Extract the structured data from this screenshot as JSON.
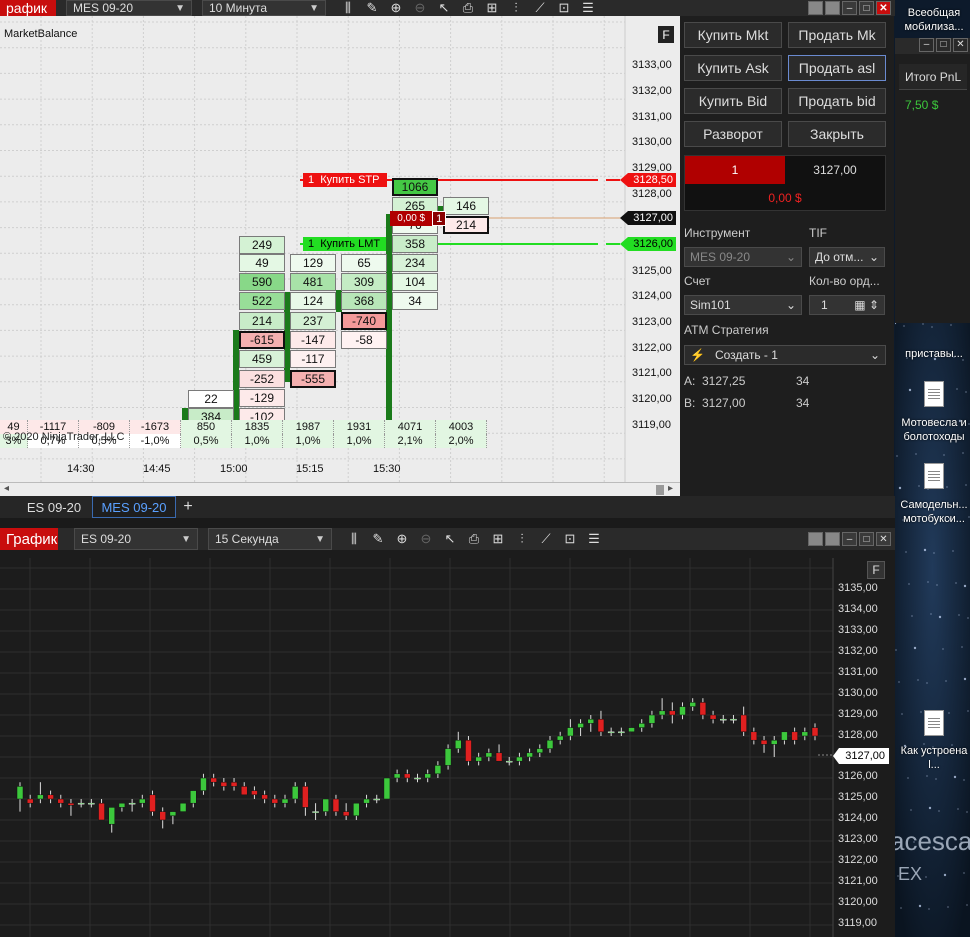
{
  "top_toolbar": {
    "title": "рафик",
    "instrument": "MES 09-20",
    "interval": "10 Минута"
  },
  "top_chart": {
    "indicator_label": "MarketBalance",
    "f_button": "F",
    "copyright": "© 2020 NinjaTrader, LLC",
    "price_labels": [
      "3133,00",
      "3132,00",
      "3131,00",
      "3130,00",
      "3129,00",
      "3128,00",
      "3125,00",
      "3124,00",
      "3123,00",
      "3122,00",
      "3121,00",
      "3120,00",
      "3119,00"
    ],
    "x_labels": [
      "14:30",
      "14:45",
      "15:00",
      "15:15",
      "15:30"
    ],
    "order_stp_qty": "1",
    "order_stp": "Купить STP",
    "order_lmt_qty": "1",
    "order_lmt": "Купить LMT",
    "stp_price": "3128,50",
    "last_price": "3127,00",
    "lmt_price": "3126,00",
    "position_pnl": "0,00 $",
    "position_qty": "1",
    "col1": [
      "249",
      "49",
      "590",
      "522",
      "214",
      "-615",
      "459",
      "-252",
      "-129",
      "-102"
    ],
    "col0": [
      "22",
      "384"
    ],
    "col2": [
      "129",
      "481",
      "124",
      "237",
      "-147",
      "-117",
      "-555"
    ],
    "col3": [
      "65",
      "309",
      "368",
      "-740",
      "-58"
    ],
    "col4": [
      "1066",
      "265",
      "76",
      "358",
      "234",
      "104",
      "34"
    ],
    "col5": [
      "146",
      "214"
    ],
    "stats_row1": [
      "49",
      "-1117",
      "-809",
      "-1673",
      "850",
      "1835",
      "1987",
      "1931",
      "4071",
      "4003"
    ],
    "stats_row2": [
      "3%",
      "0,7%",
      "0,5%",
      "-1,0%",
      "0,5%",
      "1,0%",
      "1,0%",
      "1,0%",
      "2,1%",
      "2,0%"
    ]
  },
  "tabs": {
    "tab1": "ES 09-20",
    "tab2": "MES 09-20",
    "add": "+"
  },
  "panel": {
    "buy_mkt": "Купить Mkt",
    "sell_mkt": "Продать Mk",
    "buy_ask": "Купить Ask",
    "sell_ask": "Продать asl",
    "buy_bid": "Купить Bid",
    "sell_bid": "Продать bid",
    "reverse": "Разворот",
    "close": "Закрыть",
    "position_qty": "1",
    "position_price": "3127,00",
    "position_pnl": "0,00 $",
    "instrument_label": "Инструмент",
    "tif_label": "TIF",
    "instrument_value": "MES 09-20",
    "tif_value": "До отм...",
    "account_label": "Счет",
    "qty_label": "Кол-во орд...",
    "account_value": "Sim101",
    "qty_value": "1",
    "atm_label": "ATM Стратегия",
    "atm_value": "Создать - 1",
    "ask_label": "A:",
    "ask_price": "3127,25",
    "ask_size": "34",
    "bid_label": "B:",
    "bid_price": "3127,00",
    "bid_size": "34"
  },
  "pnl_window": {
    "header": "Итого PnL",
    "value": "7,50 $"
  },
  "bottom_toolbar": {
    "title": "График",
    "instrument": "ES 09-20",
    "interval": "15 Секунда"
  },
  "bottom_chart": {
    "f_button": "F",
    "last_price": "3127,00",
    "price_labels": [
      "3135,00",
      "3134,00",
      "3133,00",
      "3132,00",
      "3131,00",
      "3130,00",
      "3129,00",
      "3128,00",
      "3126,00",
      "3125,00",
      "3124,00",
      "3123,00",
      "3122,00",
      "3121,00",
      "3120,00",
      "3119,00"
    ]
  },
  "desktop": {
    "icon1": "Всеобщая мобилиза...",
    "icon2": "приставы...",
    "icon3": "Мотовесла и болотоходы",
    "icon4": "Самодельн... мотобукси...",
    "icon5": "Как устроена l...",
    "wallpaper_text": "acesca",
    "wallpaper_text2": "EX"
  },
  "chart_data": {
    "type": "candlestick",
    "ylim": [
      3118.5,
      3135.5
    ],
    "candles": [
      [
        3124,
        3124.8,
        3123.4,
        3124.6
      ],
      [
        3124,
        3124.2,
        3123.6,
        3123.8
      ],
      [
        3124,
        3124.8,
        3123.8,
        3124.2
      ],
      [
        3124.2,
        3124.4,
        3123.8,
        3124
      ],
      [
        3124,
        3124.2,
        3123.6,
        3123.8
      ],
      [
        3123.8,
        3124,
        3123.2,
        3123.7
      ],
      [
        3123.8,
        3124,
        3123.6,
        3123.8
      ],
      [
        3123.8,
        3124,
        3123.6,
        3123.8
      ],
      [
        3123.8,
        3124,
        3123,
        3123
      ],
      [
        3122.8,
        3123.4,
        3122.4,
        3123.6
      ],
      [
        3123.6,
        3123.8,
        3123.4,
        3123.8
      ],
      [
        3123.8,
        3124,
        3123.4,
        3123.8
      ],
      [
        3123.8,
        3124.2,
        3123.6,
        3124
      ],
      [
        3124.2,
        3124.4,
        3123.2,
        3123.4
      ],
      [
        3123.4,
        3123.6,
        3122.6,
        3123
      ],
      [
        3123.2,
        3123.4,
        3122.8,
        3123.4
      ],
      [
        3123.4,
        3123.8,
        3123.4,
        3123.8
      ],
      [
        3123.8,
        3124.4,
        3123.6,
        3124.4
      ],
      [
        3124.4,
        3125.2,
        3124.2,
        3125
      ],
      [
        3125,
        3125.2,
        3124.6,
        3124.8
      ],
      [
        3124.8,
        3125,
        3124.4,
        3124.6
      ],
      [
        3124.8,
        3125,
        3124.4,
        3124.6
      ],
      [
        3124.6,
        3124.8,
        3124.2,
        3124.2
      ],
      [
        3124.4,
        3124.6,
        3124,
        3124.2
      ],
      [
        3124.2,
        3124.4,
        3123.8,
        3124
      ],
      [
        3124,
        3124.2,
        3123.6,
        3123.8
      ],
      [
        3123.8,
        3124.2,
        3123.6,
        3124
      ],
      [
        3124,
        3124.8,
        3123.8,
        3124.6
      ],
      [
        3124.6,
        3124.8,
        3123.2,
        3123.6
      ],
      [
        3123.4,
        3123.8,
        3123,
        3123.4
      ],
      [
        3123.4,
        3124,
        3123.2,
        3124
      ],
      [
        3124,
        3124.2,
        3123.2,
        3123.4
      ],
      [
        3123.4,
        3123.8,
        3123,
        3123.2
      ],
      [
        3123.2,
        3123.8,
        3123,
        3123.8
      ],
      [
        3123.8,
        3124.2,
        3123.6,
        3124
      ],
      [
        3124,
        3124.2,
        3123.8,
        3124
      ],
      [
        3124,
        3125,
        3124,
        3125
      ],
      [
        3125,
        3125.4,
        3124.8,
        3125.2
      ],
      [
        3125.2,
        3125.4,
        3124.8,
        3125
      ],
      [
        3125,
        3125.2,
        3124.8,
        3125
      ],
      [
        3125,
        3125.4,
        3124.8,
        3125.2
      ],
      [
        3125.2,
        3125.8,
        3125,
        3125.6
      ],
      [
        3125.6,
        3126.6,
        3125.4,
        3126.4
      ],
      [
        3126.4,
        3127.2,
        3126.2,
        3126.8
      ],
      [
        3126.8,
        3127,
        3125.6,
        3125.8
      ],
      [
        3125.8,
        3126.2,
        3125.6,
        3126
      ],
      [
        3126,
        3126.4,
        3125.8,
        3126.2
      ],
      [
        3126.2,
        3126.6,
        3125.8,
        3125.8
      ],
      [
        3125.8,
        3126,
        3125.6,
        3125.8
      ],
      [
        3125.8,
        3126.2,
        3125.6,
        3126
      ],
      [
        3126,
        3126.4,
        3125.8,
        3126.2
      ],
      [
        3126.2,
        3126.6,
        3126,
        3126.4
      ],
      [
        3126.4,
        3127,
        3126.2,
        3126.8
      ],
      [
        3126.8,
        3127.2,
        3126.6,
        3127
      ],
      [
        3127,
        3127.8,
        3126.8,
        3127.4
      ],
      [
        3127.4,
        3127.8,
        3127,
        3127.6
      ],
      [
        3127.6,
        3128,
        3127.2,
        3127.8
      ],
      [
        3127.8,
        3128.2,
        3127,
        3127.2
      ],
      [
        3127.2,
        3127.4,
        3127,
        3127.2
      ],
      [
        3127.2,
        3127.4,
        3127,
        3127.2
      ],
      [
        3127.2,
        3127.4,
        3127.2,
        3127.4
      ],
      [
        3127.4,
        3127.8,
        3127.2,
        3127.6
      ],
      [
        3127.6,
        3128.2,
        3127.4,
        3128
      ],
      [
        3128,
        3128.8,
        3127.8,
        3128.2
      ],
      [
        3128.2,
        3128.6,
        3127.6,
        3128
      ],
      [
        3128,
        3128.6,
        3127.8,
        3128.4
      ],
      [
        3128.4,
        3128.8,
        3128.2,
        3128.6
      ],
      [
        3128.6,
        3128.8,
        3127.8,
        3128
      ],
      [
        3128,
        3128.2,
        3127.6,
        3127.8
      ],
      [
        3127.8,
        3128,
        3127.6,
        3127.8
      ],
      [
        3127.8,
        3128,
        3127.6,
        3127.8
      ],
      [
        3128,
        3128.4,
        3127,
        3127.2
      ],
      [
        3127.2,
        3127.4,
        3126.6,
        3126.8
      ],
      [
        3126.8,
        3127,
        3126.2,
        3126.6
      ],
      [
        3126.6,
        3127,
        3126,
        3126.8
      ],
      [
        3126.8,
        3127.2,
        3126.6,
        3127.2
      ],
      [
        3127.2,
        3127.4,
        3126.6,
        3126.8
      ],
      [
        3127,
        3127.4,
        3126.8,
        3127.2
      ],
      [
        3127.4,
        3127.6,
        3126.8,
        3127
      ]
    ]
  }
}
